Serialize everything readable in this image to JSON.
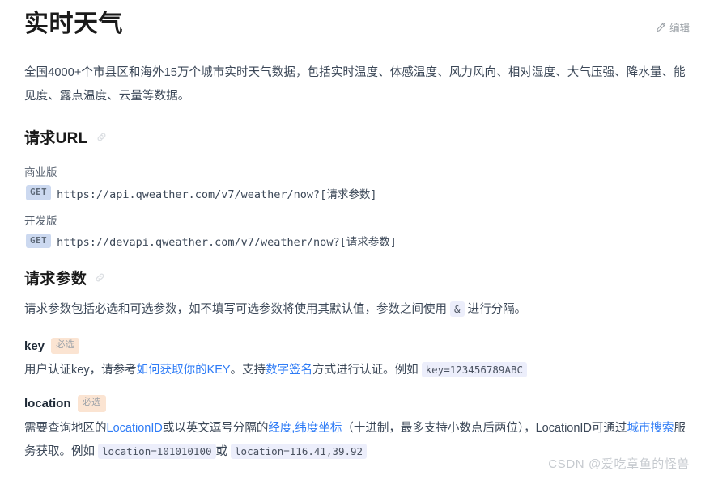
{
  "header": {
    "title": "实时天气",
    "edit_label": "编辑",
    "edit_icon": "pencil-icon"
  },
  "description": "全国4000+个市县区和海外15万个城市实时天气数据，包括实时温度、体感温度、风力风向、相对湿度、大气压强、降水量、能见度、露点温度、云量等数据。",
  "sections": {
    "request_url": {
      "heading": "请求URL",
      "anchor_icon": "link-icon",
      "entries": [
        {
          "version_label": "商业版",
          "method": "GET",
          "url": "https://api.qweather.com/v7/weather/now?[请求参数]"
        },
        {
          "version_label": "开发版",
          "method": "GET",
          "url": "https://devapi.qweather.com/v7/weather/now?[请求参数]"
        }
      ]
    },
    "request_params": {
      "heading": "请求参数",
      "anchor_icon": "link-icon",
      "intro": {
        "part1": "请求参数包括必选和可选参数，如不填写可选参数将使用其默认值，参数之间使用",
        "code": "&",
        "part2": "进行分隔。"
      },
      "params": [
        {
          "name": "key",
          "badge": "必选",
          "desc": {
            "t1": "用户认证key，请参考",
            "link1": "如何获取你的KEY",
            "t2": "。支持",
            "link2": "数字签名",
            "t3": "方式进行认证。例如",
            "code1": "key=123456789ABC"
          }
        },
        {
          "name": "location",
          "badge": "必选",
          "desc": {
            "t1": "需要查询地区的",
            "link1": "LocationID",
            "t2": "或以英文逗号分隔的",
            "link2": "经度,纬度坐标",
            "t3": "（十进制，最多支持小数点后两位），LocationID可通过",
            "link3": "城市搜索",
            "t4": "服务获取。例如",
            "code1": "location=101010100",
            "t5": "或",
            "code2": "location=116.41,39.92"
          }
        }
      ]
    }
  },
  "watermark": "CSDN @爱吃章鱼的怪兽",
  "colors": {
    "link": "#2f7cf6",
    "get_badge_bg": "#ccd9f0",
    "required_badge_bg": "#fbe4d2",
    "code_bg": "#eceefb"
  }
}
